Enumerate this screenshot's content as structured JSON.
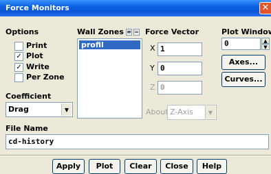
{
  "window": {
    "title": "Force Monitors",
    "close_glyph": "✕"
  },
  "options": {
    "label": "Options",
    "items": [
      {
        "label": "Print",
        "checked": false
      },
      {
        "label": "Plot",
        "checked": true
      },
      {
        "label": "Write",
        "checked": true
      },
      {
        "label": "Per Zone",
        "checked": false
      }
    ]
  },
  "wall_zones": {
    "label": "Wall Zones",
    "select_all_glyph": "≡",
    "deselect_glyph": "=",
    "items": [
      "profil"
    ]
  },
  "force_vector": {
    "label": "Force Vector",
    "x_label": "X",
    "x_value": "1",
    "y_label": "Y",
    "y_value": "0",
    "z_label": "Z",
    "z_value": "0"
  },
  "about": {
    "label": "About",
    "value": "Z-Axis"
  },
  "plot_window": {
    "label": "Plot Window",
    "value": "0"
  },
  "axes_button": "Axes...",
  "curves_button": "Curves...",
  "coefficient": {
    "label": "Coefficient",
    "value": "Drag"
  },
  "file_name": {
    "label": "File Name",
    "value": "cd-history"
  },
  "buttons": {
    "apply": "Apply",
    "plot": "Plot",
    "clear": "Clear",
    "close": "Close",
    "help": "Help"
  }
}
